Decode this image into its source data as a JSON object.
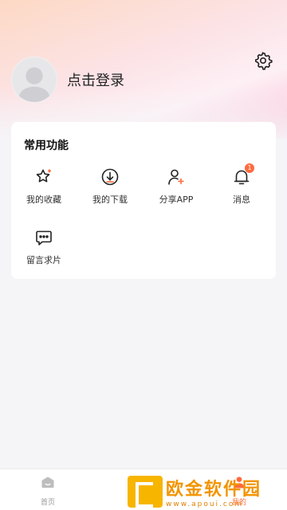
{
  "profile": {
    "login_label": "点击登录"
  },
  "functions": {
    "title": "常用功能",
    "items": [
      {
        "label": "我的收藏",
        "icon": "star-icon"
      },
      {
        "label": "我的下载",
        "icon": "download-icon"
      },
      {
        "label": "分享APP",
        "icon": "share-user-icon"
      },
      {
        "label": "消息",
        "icon": "bell-icon",
        "badge": "1"
      },
      {
        "label": "留言求片",
        "icon": "message-icon"
      }
    ]
  },
  "tabbar": {
    "items": [
      {
        "label": "首页",
        "icon": "home-icon"
      },
      {
        "label": "",
        "icon": "discover-icon"
      },
      {
        "label": "我的",
        "icon": "profile-icon"
      }
    ]
  },
  "watermark": {
    "name": "欧金软件园",
    "url": "www.apoui.com"
  },
  "colors": {
    "accent": "#ff6a3d",
    "brand_watermark": "#f29400"
  }
}
